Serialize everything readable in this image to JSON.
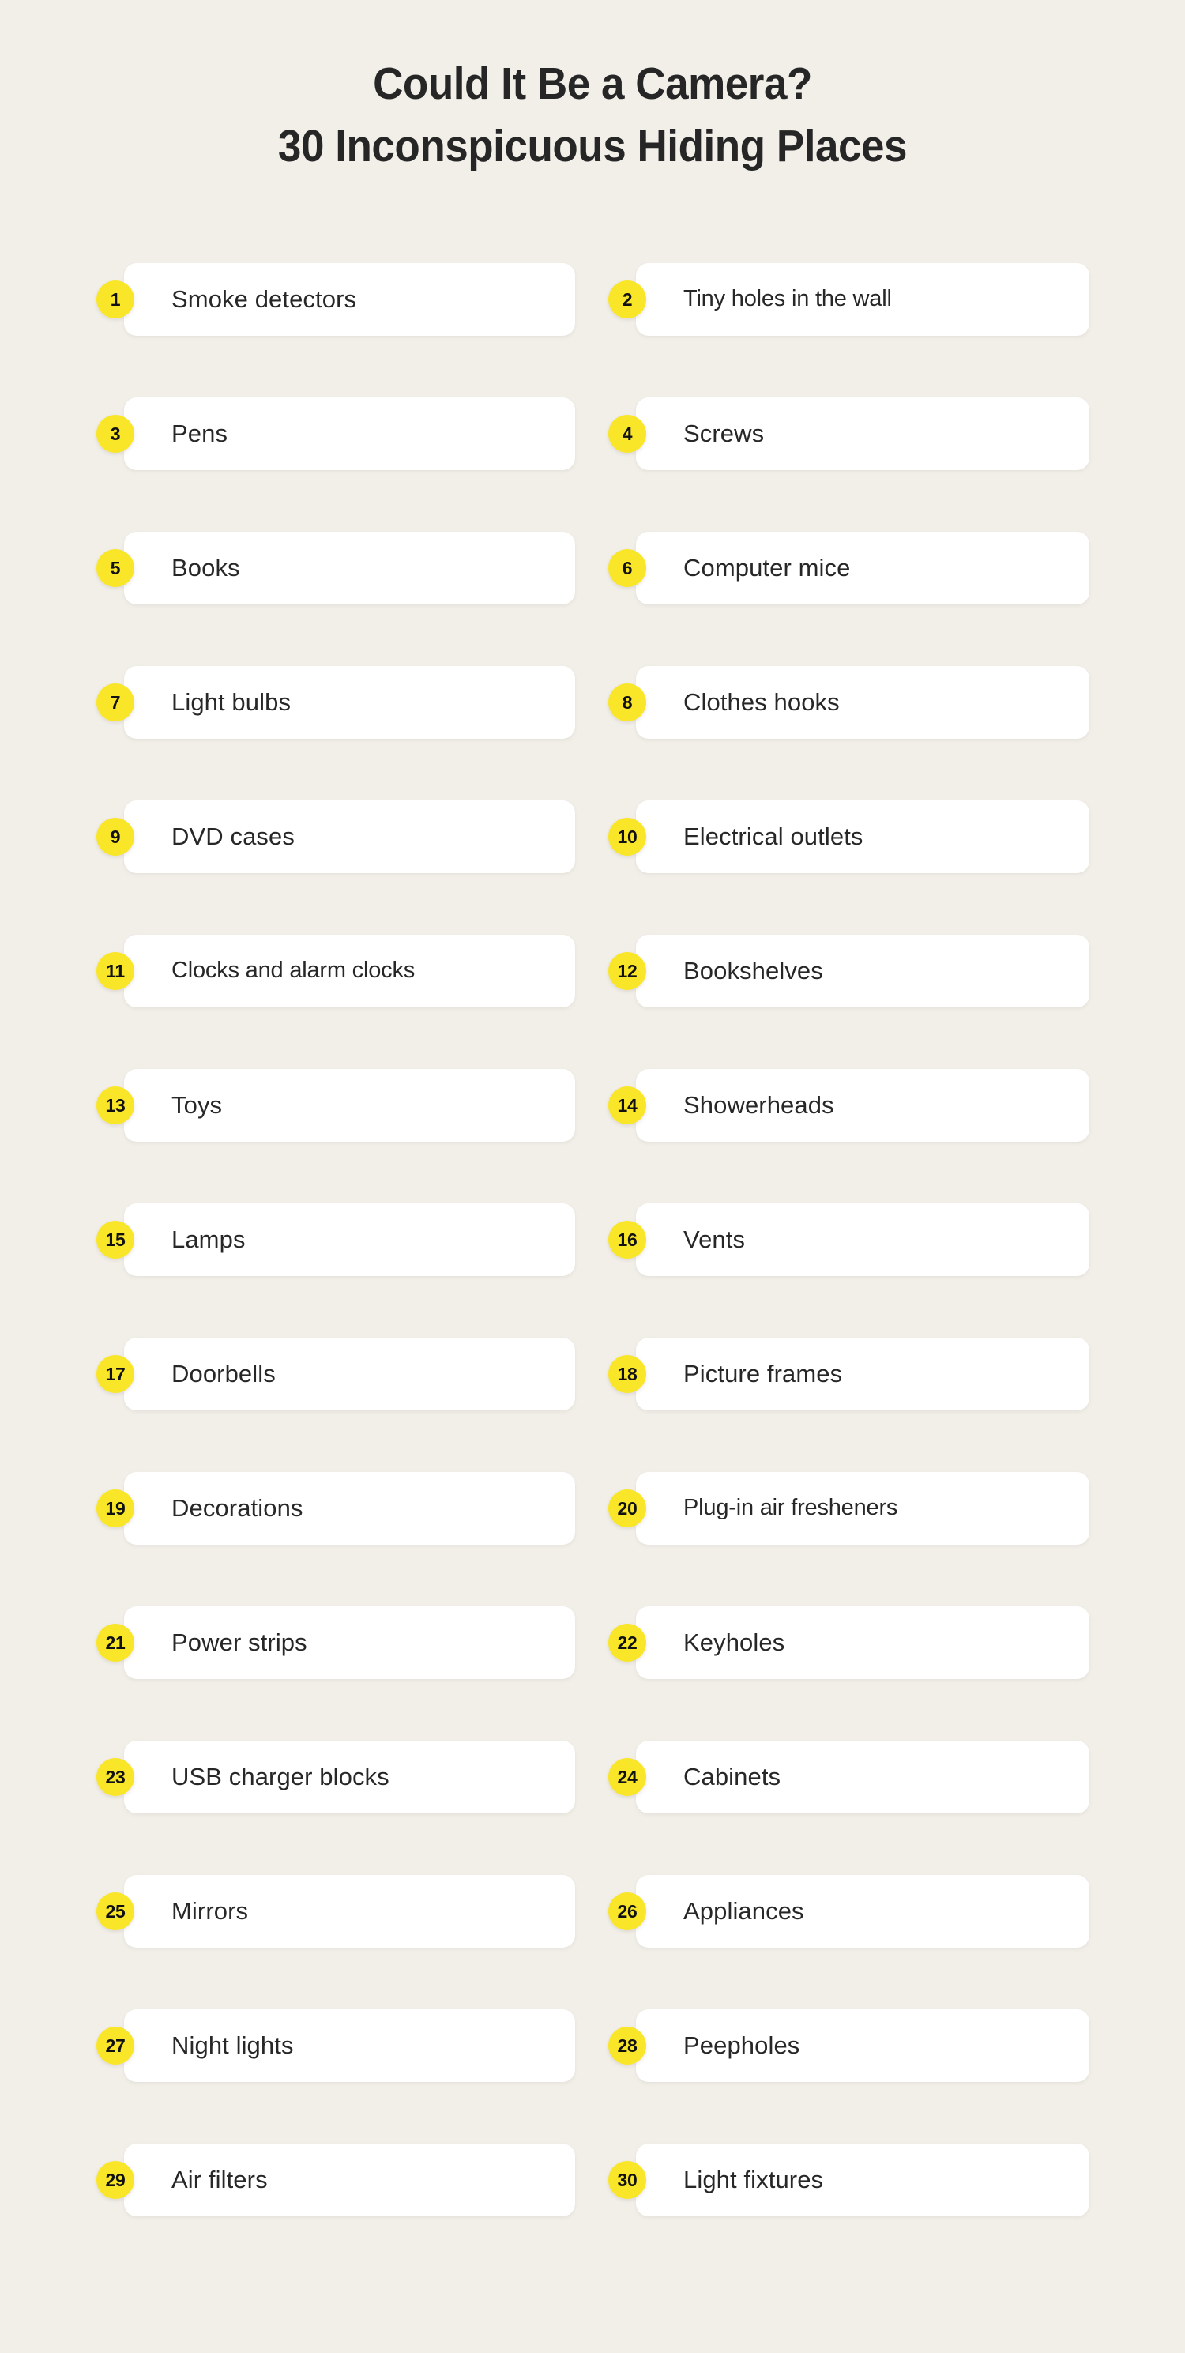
{
  "theme": {
    "background": "#f2efe9",
    "card_background": "#ffffff",
    "badge_color": "#fae629",
    "text_color": "#272727",
    "title_color": "#262626"
  },
  "header": {
    "title_line_1": "Could It Be a Camera?",
    "title_line_2": "30 Inconspicuous Hiding Places"
  },
  "list": {
    "total": 30,
    "left_column": [
      {
        "number": "1",
        "label": "Smoke detectors"
      },
      {
        "number": "3",
        "label": "Pens"
      },
      {
        "number": "5",
        "label": "Books"
      },
      {
        "number": "7",
        "label": "Light bulbs"
      },
      {
        "number": "9",
        "label": "DVD cases"
      },
      {
        "number": "11",
        "label": "Clocks and alarm clocks"
      },
      {
        "number": "13",
        "label": "Toys"
      },
      {
        "number": "15",
        "label": "Lamps"
      },
      {
        "number": "17",
        "label": "Doorbells"
      },
      {
        "number": "19",
        "label": "Decorations"
      },
      {
        "number": "21",
        "label": "Power strips"
      },
      {
        "number": "23",
        "label": "USB charger blocks"
      },
      {
        "number": "25",
        "label": "Mirrors"
      },
      {
        "number": "27",
        "label": "Night lights"
      },
      {
        "number": "29",
        "label": "Air filters"
      }
    ],
    "right_column": [
      {
        "number": "2",
        "label": "Tiny holes in the wall"
      },
      {
        "number": "4",
        "label": "Screws"
      },
      {
        "number": "6",
        "label": "Computer mice"
      },
      {
        "number": "8",
        "label": "Clothes hooks"
      },
      {
        "number": "10",
        "label": "Electrical outlets"
      },
      {
        "number": "12",
        "label": "Bookshelves"
      },
      {
        "number": "14",
        "label": "Showerheads"
      },
      {
        "number": "16",
        "label": "Vents"
      },
      {
        "number": "18",
        "label": "Picture frames"
      },
      {
        "number": "20",
        "label": "Plug-in air fresheners"
      },
      {
        "number": "22",
        "label": "Keyholes"
      },
      {
        "number": "24",
        "label": "Cabinets"
      },
      {
        "number": "26",
        "label": "Appliances"
      },
      {
        "number": "28",
        "label": "Peepholes"
      },
      {
        "number": "30",
        "label": "Light fixtures"
      }
    ]
  }
}
